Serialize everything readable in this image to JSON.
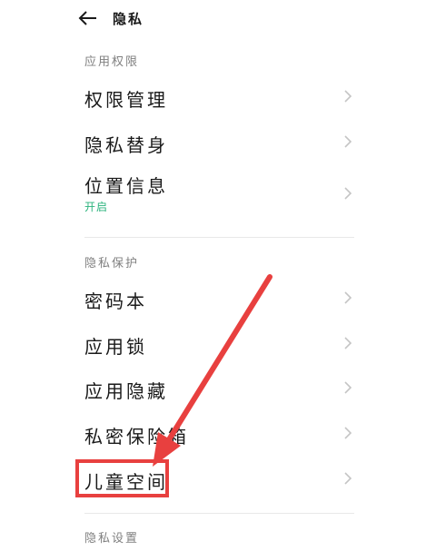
{
  "header": {
    "title": "隐私",
    "back_icon": "back-arrow-icon"
  },
  "sections": [
    {
      "title": "应用权限",
      "items": [
        {
          "label": "权限管理"
        },
        {
          "label": "隐私替身"
        },
        {
          "label": "位置信息",
          "sub": "开启"
        }
      ]
    },
    {
      "title": "隐私保护",
      "items": [
        {
          "label": "密码本"
        },
        {
          "label": "应用锁"
        },
        {
          "label": "应用隐藏"
        },
        {
          "label": "私密保险箱"
        },
        {
          "label": "儿童空间"
        }
      ]
    },
    {
      "title": "隐私设置"
    }
  ],
  "colors": {
    "accent_green": "#2bb37d",
    "annotation_red": "#e8403f",
    "chevron": "#c4c4c4",
    "section_title": "#808080"
  }
}
